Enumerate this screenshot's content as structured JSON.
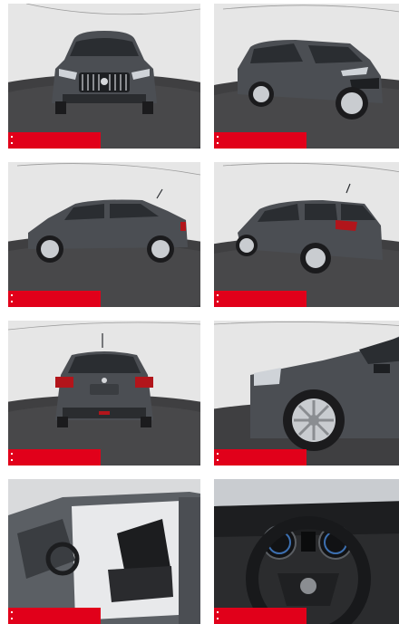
{
  "gallery": {
    "tiles": [
      {
        "view": "front"
      },
      {
        "view": "front-three-quarter"
      },
      {
        "view": "side-profile"
      },
      {
        "view": "rear-three-quarter"
      },
      {
        "view": "rear"
      },
      {
        "view": "front-wheel-detail"
      },
      {
        "view": "interior-front-seats"
      },
      {
        "view": "dashboard-steering-wheel"
      }
    ]
  },
  "colors": {
    "badge": "#e1001a",
    "car_body": "#4b4e53",
    "turntable": "#3f3f41",
    "backdrop": "#e8e8e8"
  }
}
